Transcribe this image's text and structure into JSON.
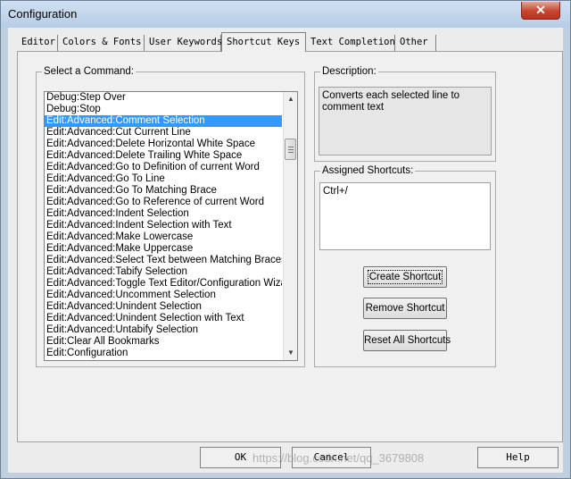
{
  "window": {
    "title": "Configuration",
    "close_glyph": "✕"
  },
  "tabs": [
    {
      "label": "Editor"
    },
    {
      "label": "Colors & Fonts"
    },
    {
      "label": "User Keywords"
    },
    {
      "label": "Shortcut Keys",
      "active": true
    },
    {
      "label": "Text Completion"
    },
    {
      "label": "Other"
    }
  ],
  "command_group": {
    "label": "Select a Command:",
    "selected_index": 2,
    "items": [
      "Debug:Step Over",
      "Debug:Stop",
      "Edit:Advanced:Comment Selection",
      "Edit:Advanced:Cut Current Line",
      "Edit:Advanced:Delete Horizontal White Space",
      "Edit:Advanced:Delete Trailing White Space",
      "Edit:Advanced:Go to Definition of current Word",
      "Edit:Advanced:Go To Line",
      "Edit:Advanced:Go To Matching Brace",
      "Edit:Advanced:Go to Reference of current Word",
      "Edit:Advanced:Indent Selection",
      "Edit:Advanced:Indent Selection with Text",
      "Edit:Advanced:Make Lowercase",
      "Edit:Advanced:Make Uppercase",
      "Edit:Advanced:Select Text between Matching Braces",
      "Edit:Advanced:Tabify Selection",
      "Edit:Advanced:Toggle Text Editor/Configuration Wizard",
      "Edit:Advanced:Uncomment Selection",
      "Edit:Advanced:Unindent Selection",
      "Edit:Advanced:Unindent Selection with Text",
      "Edit:Advanced:Untabify Selection",
      "Edit:Clear All Bookmarks",
      "Edit:Configuration"
    ]
  },
  "description_group": {
    "label": "Description:",
    "text": "Converts each selected line to comment text"
  },
  "shortcuts_group": {
    "label": "Assigned Shortcuts:",
    "value": "Ctrl+/",
    "create_label": "Create Shortcut",
    "remove_label": "Remove Shortcut",
    "reset_label": "Reset All Shortcuts"
  },
  "footer": {
    "ok_label": "OK",
    "cancel_label": "Cancel",
    "help_label": "Help"
  },
  "watermark": "https://blog.csdn.net/qq_3679808"
}
